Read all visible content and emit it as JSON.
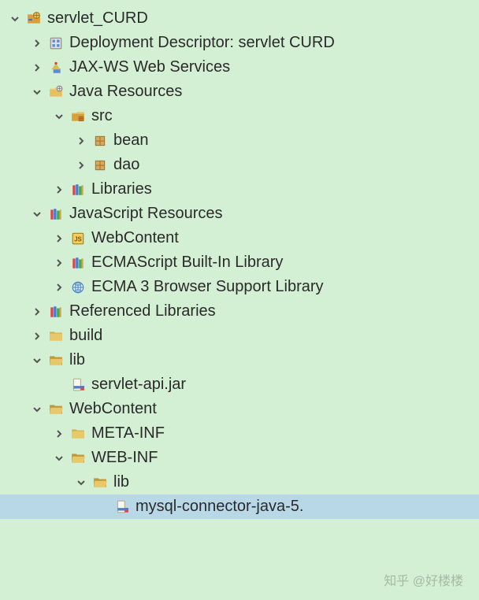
{
  "watermark": "知乎 @好楼楼",
  "tree": [
    {
      "label": "servlet_CURD",
      "icon": "project",
      "indent": 0,
      "expander": "open"
    },
    {
      "label": "Deployment Descriptor: servlet CURD",
      "icon": "deployment-descriptor",
      "indent": 1,
      "expander": "closed"
    },
    {
      "label": "JAX-WS Web Services",
      "icon": "jax-ws",
      "indent": 1,
      "expander": "closed"
    },
    {
      "label": "Java Resources",
      "icon": "java-resources",
      "indent": 1,
      "expander": "open"
    },
    {
      "label": "src",
      "icon": "source-folder",
      "indent": 2,
      "expander": "open"
    },
    {
      "label": "bean",
      "icon": "package",
      "indent": 3,
      "expander": "closed"
    },
    {
      "label": "dao",
      "icon": "package",
      "indent": 3,
      "expander": "closed"
    },
    {
      "label": "Libraries",
      "icon": "library",
      "indent": 2,
      "expander": "closed"
    },
    {
      "label": "JavaScript Resources",
      "icon": "library",
      "indent": 1,
      "expander": "open"
    },
    {
      "label": "WebContent",
      "icon": "webcontent",
      "indent": 2,
      "expander": "closed"
    },
    {
      "label": "ECMAScript Built-In Library",
      "icon": "library",
      "indent": 2,
      "expander": "closed"
    },
    {
      "label": "ECMA 3 Browser Support Library",
      "icon": "globe",
      "indent": 2,
      "expander": "closed"
    },
    {
      "label": "Referenced Libraries",
      "icon": "library",
      "indent": 1,
      "expander": "closed"
    },
    {
      "label": "build",
      "icon": "folder",
      "indent": 1,
      "expander": "closed"
    },
    {
      "label": "lib",
      "icon": "folder-open",
      "indent": 1,
      "expander": "open"
    },
    {
      "label": "servlet-api.jar",
      "icon": "jar",
      "indent": 2,
      "expander": "none"
    },
    {
      "label": "WebContent",
      "icon": "folder-open",
      "indent": 1,
      "expander": "open"
    },
    {
      "label": "META-INF",
      "icon": "folder",
      "indent": 2,
      "expander": "closed"
    },
    {
      "label": "WEB-INF",
      "icon": "folder-open",
      "indent": 2,
      "expander": "open"
    },
    {
      "label": "lib",
      "icon": "folder-open",
      "indent": 3,
      "expander": "open"
    },
    {
      "label": "mysql-connector-java-5.",
      "icon": "jar",
      "indent": 4,
      "expander": "none",
      "selected": true
    }
  ]
}
